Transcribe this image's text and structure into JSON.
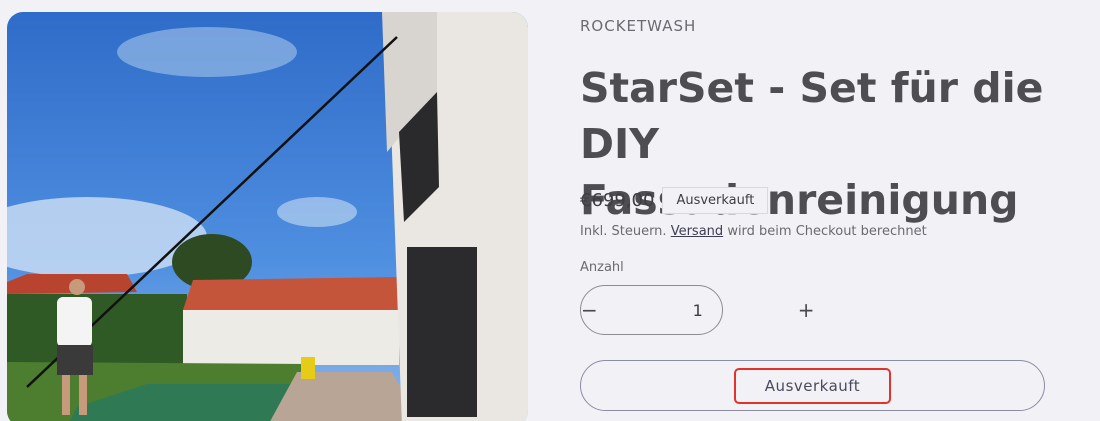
{
  "product": {
    "vendor": "ROCKETWASH",
    "title": "StarSet - Set für die DIY\nFassadenreinigung",
    "price": "€699,00",
    "badge": "Ausverkauft",
    "tax_prefix": "Inkl. Steuern.",
    "tax_link": "Versand",
    "tax_suffix": "wird beim Checkout berechnet",
    "quantity_label": "Anzahl",
    "quantity_value": "1",
    "quantity_minus": "−",
    "quantity_plus": "+",
    "button_label": "Ausverkauft"
  },
  "image": {
    "alt": "Mann reinigt Hausfassade mit Teleskopstange im Garten"
  },
  "colors": {
    "background": "#f1f1f6",
    "highlight": "#e0332b",
    "sky": "#3f7fd6",
    "roof": "#c4553a"
  }
}
